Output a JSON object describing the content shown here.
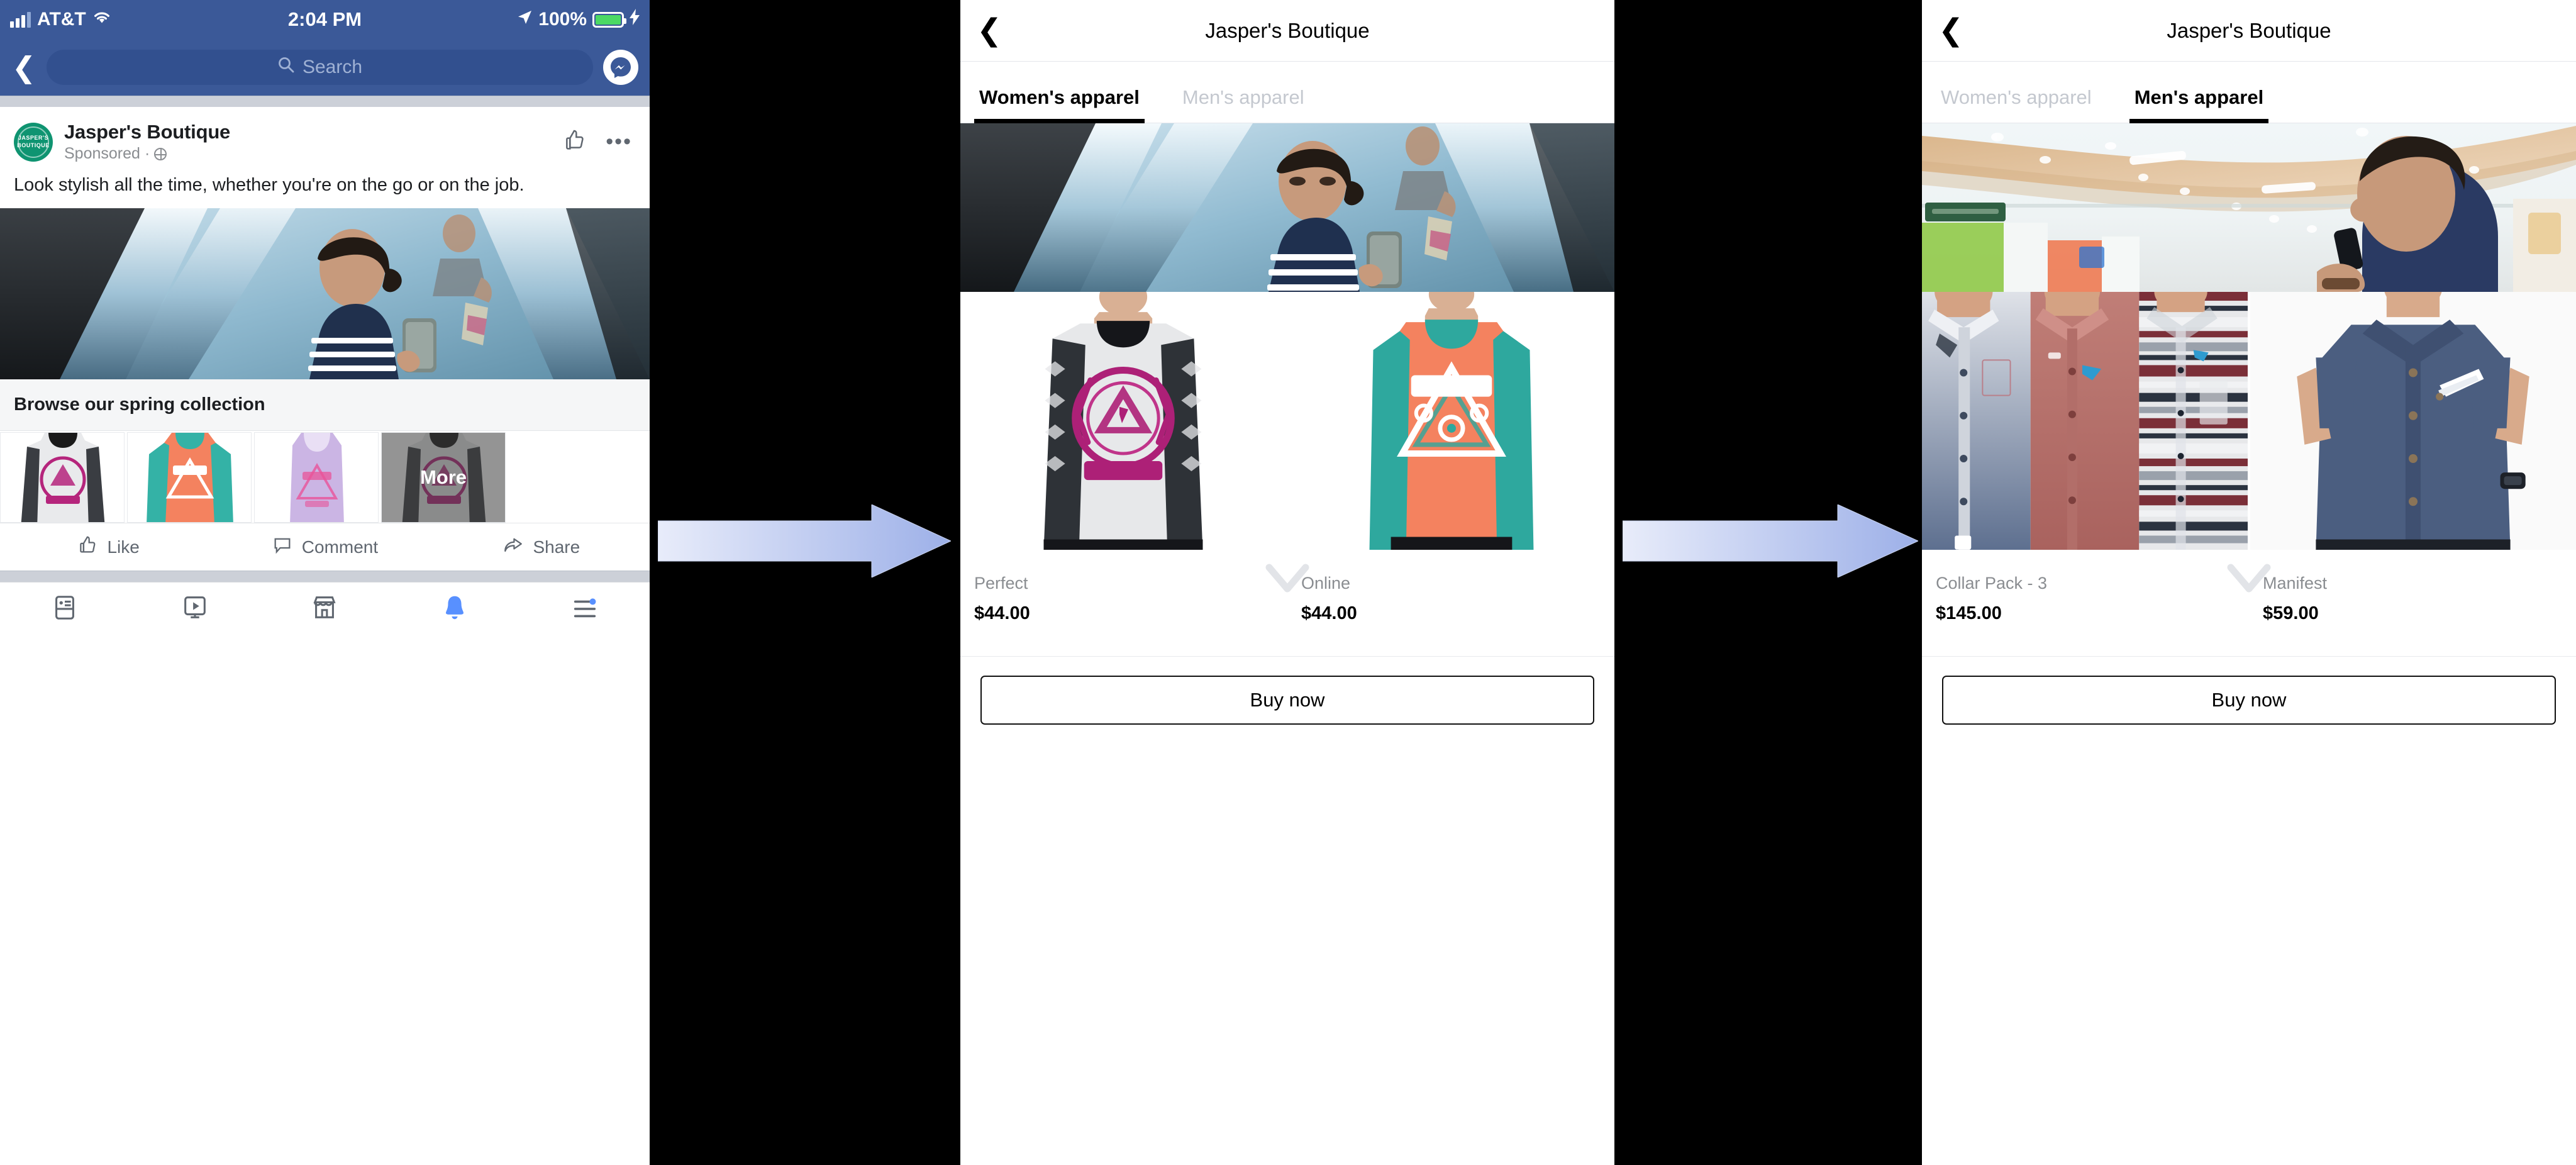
{
  "phone1": {
    "status_bar": {
      "carrier": "AT&T",
      "time": "2:04 PM",
      "battery_percent": "100%",
      "signal_icon": "signal-bars-icon",
      "wifi_icon": "wifi-icon",
      "location_icon": "location-arrow-icon",
      "battery_icon": "battery-icon",
      "charging_icon": "lightning-bolt-icon"
    },
    "nav": {
      "back_icon": "chevron-left-icon",
      "search_placeholder": "Search",
      "search_icon": "search-icon",
      "messenger_icon": "messenger-icon"
    },
    "post": {
      "page_name": "Jasper's Boutique",
      "sponsored_label": "Sponsored",
      "privacy_icon": "globe-icon",
      "like_thumb_icon": "thumbs-up-outline-icon",
      "more_icon": "ellipsis-icon",
      "body_text": "Look stylish all the time, whether you're on the go or on the job.",
      "avatar_text": "JASPER'S BOUTIQUE"
    },
    "collection": {
      "title": "Browse our spring collection",
      "more_label": "More",
      "thumbs": [
        {
          "name": "society-live-free-grey-top"
        },
        {
          "name": "society-coral-teal-raglan"
        },
        {
          "name": "society-lilac-tank"
        },
        {
          "name": "society-live-free-grey-top-more"
        }
      ]
    },
    "action_bar": [
      {
        "label": "Like",
        "icon": "thumbs-up-outline-icon"
      },
      {
        "label": "Comment",
        "icon": "comment-bubble-icon"
      },
      {
        "label": "Share",
        "icon": "share-arrow-icon"
      }
    ],
    "tab_bar": [
      {
        "name": "news-feed-tab",
        "icon": "news-feed-icon",
        "active": false
      },
      {
        "name": "watch-tab",
        "icon": "watch-video-icon",
        "active": false
      },
      {
        "name": "marketplace-tab",
        "icon": "marketplace-store-icon",
        "active": false
      },
      {
        "name": "notifications-tab",
        "icon": "bell-icon",
        "active": true
      },
      {
        "name": "menu-tab",
        "icon": "menu-lines-icon",
        "active": false
      }
    ],
    "colors": {
      "facebook_blue": "#3b5998",
      "search_field": "#32508f",
      "accent_blue": "#5890ff",
      "avatar_green": "#0f9471"
    }
  },
  "arrows": [
    {
      "name": "flow-arrow-1"
    },
    {
      "name": "flow-arrow-2"
    }
  ],
  "phone2": {
    "nav": {
      "back_icon": "chevron-left-icon",
      "title": "Jasper's Boutique"
    },
    "tabs": [
      {
        "label": "Women's apparel",
        "active": true
      },
      {
        "label": "Men's apparel",
        "active": false
      }
    ],
    "hero": {
      "name": "woman-on-escalator-with-phone"
    },
    "products": [
      {
        "name": "Perfect",
        "price": "$44.00",
        "image": "society-grey-aztec-long-sleeve"
      },
      {
        "name": "Online",
        "price": "$44.00",
        "image": "society-coral-teal-raglan"
      }
    ],
    "chevron_icon": "chevron-down-icon",
    "buy_label": "Buy now"
  },
  "phone3": {
    "nav": {
      "back_icon": "chevron-left-icon",
      "title": "Jasper's Boutique"
    },
    "tabs": [
      {
        "label": "Women's apparel",
        "active": false
      },
      {
        "label": "Men's apparel",
        "active": true
      }
    ],
    "hero": {
      "name": "man-in-mall-on-phone"
    },
    "products": [
      {
        "name": "Collar Pack - 3",
        "price": "$145.00",
        "image": "three-collar-shirts"
      },
      {
        "name": "Manifest",
        "price": "$59.00",
        "image": "denim-short-sleeve-shirt"
      }
    ],
    "chevron_icon": "chevron-down-icon",
    "buy_label": "Buy now"
  }
}
